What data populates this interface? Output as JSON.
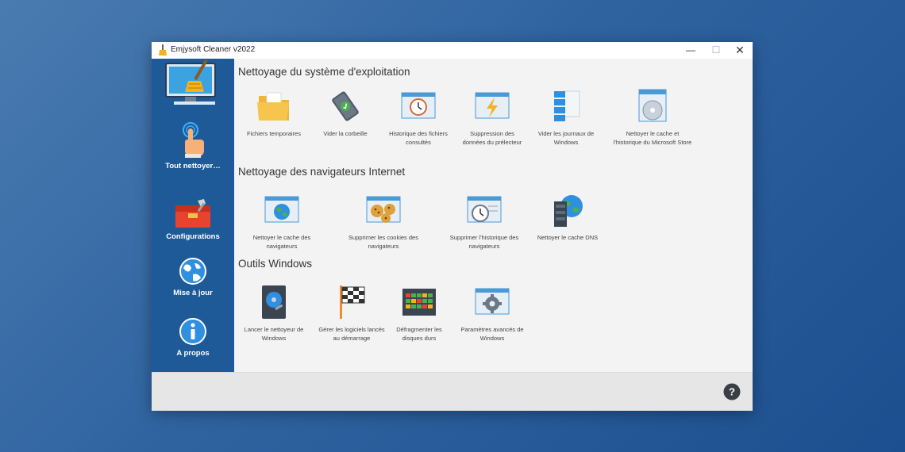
{
  "window": {
    "title": "Emjysoft Cleaner v2022",
    "min_label": "—",
    "max_label": "☐",
    "close_label": "✕"
  },
  "sidebar": {
    "items": [
      {
        "label": "Tout nettoyer…",
        "icon": "hand-pointer-icon"
      },
      {
        "label": "Configurations",
        "icon": "toolbox-icon"
      },
      {
        "label": "Mise à jour",
        "icon": "globe-icon"
      },
      {
        "label": "A propos",
        "icon": "info-icon"
      }
    ]
  },
  "sections": [
    {
      "title": "Nettoyage du système d'exploitation",
      "tiles": [
        {
          "line1": "Fichiers temporaires",
          "line2": "",
          "icon": "folder-icon"
        },
        {
          "line1": "Vider la corbeille",
          "line2": "",
          "icon": "recycle-bin-icon"
        },
        {
          "line1": "Historique des fichiers",
          "line2": "consultés",
          "icon": "clock-window-icon"
        },
        {
          "line1": "Suppression des",
          "line2": "données du prélecteur",
          "icon": "lightning-window-icon"
        },
        {
          "line1": "Vider les journaux de",
          "line2": "Windows",
          "icon": "logs-icon"
        },
        {
          "line1": "Nettoyer le cache et",
          "line2": "l'historique du Microsoft Store",
          "icon": "store-disc-icon"
        }
      ]
    },
    {
      "title": "Nettoyage des navigateurs Internet",
      "tiles": [
        {
          "line1": "Nettoyer le cache des",
          "line2": "navigateurs",
          "icon": "globe-window-icon"
        },
        {
          "line1": "Supprimer les cookies des",
          "line2": "navigateurs",
          "icon": "cookies-window-icon"
        },
        {
          "line1": "Supprimer l'historique des",
          "line2": "navigateurs",
          "icon": "clock-browser-icon"
        },
        {
          "line1": "Nettoyer le cache DNS",
          "line2": "",
          "icon": "dns-server-icon"
        }
      ]
    },
    {
      "title": "Outils Windows",
      "tiles": [
        {
          "line1": "Lancer le nettoyeur de",
          "line2": "Windows",
          "icon": "hard-drive-icon"
        },
        {
          "line1": "Gérer les logiciels lancés",
          "line2": "au démarrage",
          "icon": "checkered-flag-icon"
        },
        {
          "line1": "Défragmenter les",
          "line2": "disques durs",
          "icon": "defrag-icon"
        },
        {
          "line1": "Paramètres avancés de",
          "line2": "Windows",
          "icon": "gear-window-icon"
        }
      ]
    }
  ],
  "footer": {
    "help_label": "?"
  },
  "colors": {
    "sidebar": "#1f5a98",
    "background": "#f3f3f3",
    "accent": "#2f63a0"
  }
}
